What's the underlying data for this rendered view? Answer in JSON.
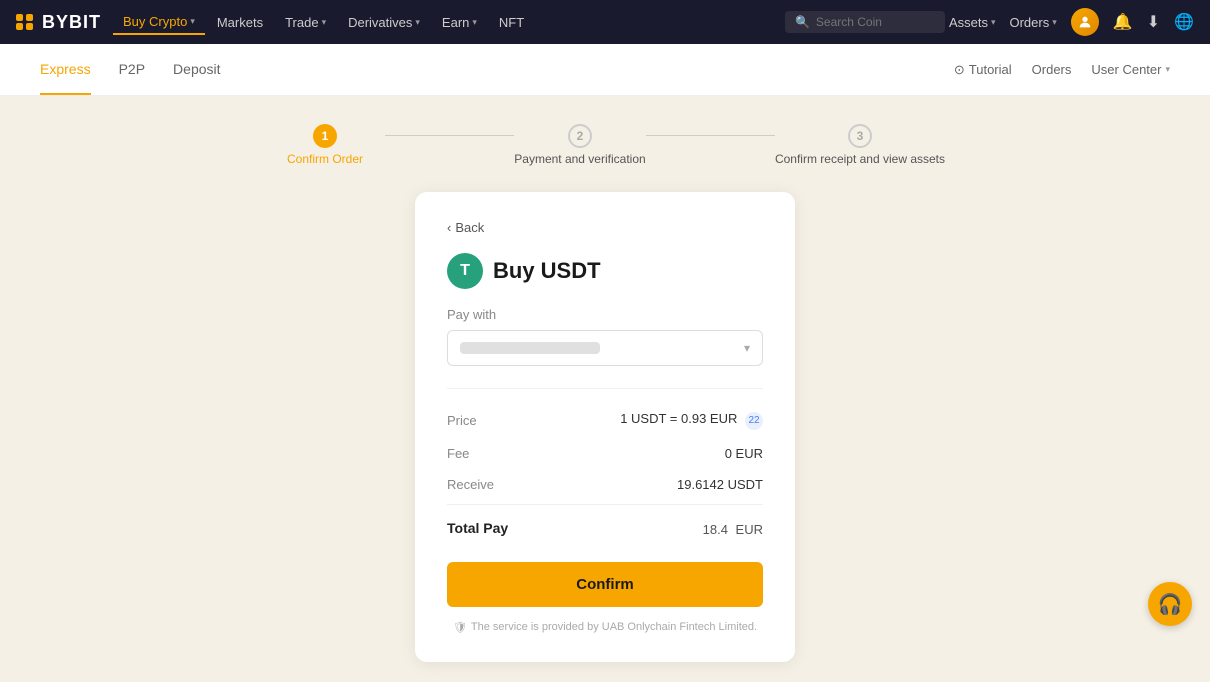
{
  "navbar": {
    "logo": "BYBIT",
    "nav_items": [
      {
        "label": "Buy Crypto",
        "active": true,
        "has_arrow": true
      },
      {
        "label": "Markets",
        "active": false,
        "has_arrow": false
      },
      {
        "label": "Trade",
        "active": false,
        "has_arrow": true
      },
      {
        "label": "Derivatives",
        "active": false,
        "has_arrow": true
      },
      {
        "label": "Earn",
        "active": false,
        "has_arrow": true
      },
      {
        "label": "NFT",
        "active": false,
        "has_arrow": false
      }
    ],
    "search_placeholder": "Search Coin",
    "right_items": [
      {
        "label": "Assets",
        "has_arrow": true
      },
      {
        "label": "Orders",
        "has_arrow": true
      }
    ]
  },
  "sub_navbar": {
    "tabs": [
      {
        "label": "Express",
        "active": true
      },
      {
        "label": "P2P",
        "active": false
      },
      {
        "label": "Deposit",
        "active": false
      }
    ],
    "right_items": [
      {
        "label": "Tutorial"
      },
      {
        "label": "Orders"
      },
      {
        "label": "User Center",
        "has_arrow": true
      }
    ]
  },
  "stepper": {
    "steps": [
      {
        "number": "1",
        "label": "Confirm Order",
        "active": true
      },
      {
        "number": "2",
        "label": "Payment and verification",
        "active": false
      },
      {
        "number": "3",
        "label": "Confirm receipt and view assets",
        "active": false
      }
    ]
  },
  "card": {
    "back_label": "Back",
    "title": "Buy USDT",
    "pay_with_label": "Pay with",
    "price_label": "Price",
    "price_value": "1 USDT = 0.93 EUR",
    "price_badge": "22",
    "fee_label": "Fee",
    "fee_value": "0 EUR",
    "receive_label": "Receive",
    "receive_value": "19.6142 USDT",
    "total_label": "Total Pay",
    "total_amount": "18.4",
    "total_currency": "EUR",
    "confirm_button": "Confirm",
    "footer_note": "The service is provided by UAB Onlychain Fintech Limited."
  },
  "help_button": "🎧"
}
